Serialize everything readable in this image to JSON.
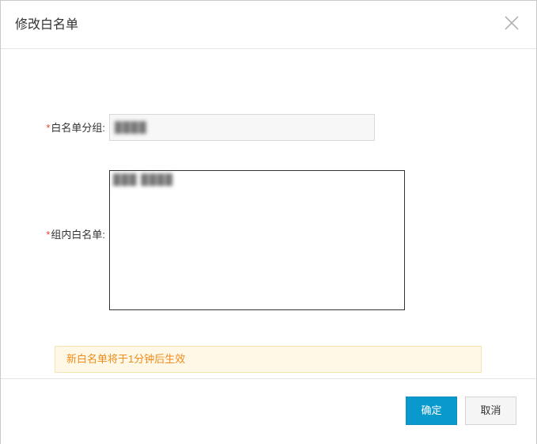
{
  "dialog": {
    "title": "修改白名单",
    "close_icon": "close-icon"
  },
  "form": {
    "group_field": {
      "required_mark": "*",
      "label": "白名单分组:",
      "value": "████"
    },
    "list_field": {
      "required_mark": "*",
      "label": "组内白名单:",
      "value": "███ ████"
    }
  },
  "notice": {
    "text": "新白名单将于1分钟后生效"
  },
  "footer": {
    "confirm_label": "确定",
    "cancel_label": "取消"
  },
  "colors": {
    "primary": "#0a99cc",
    "required": "#e6452c",
    "notice_text": "#ef8b1a",
    "notice_bg": "#fff8e6"
  }
}
